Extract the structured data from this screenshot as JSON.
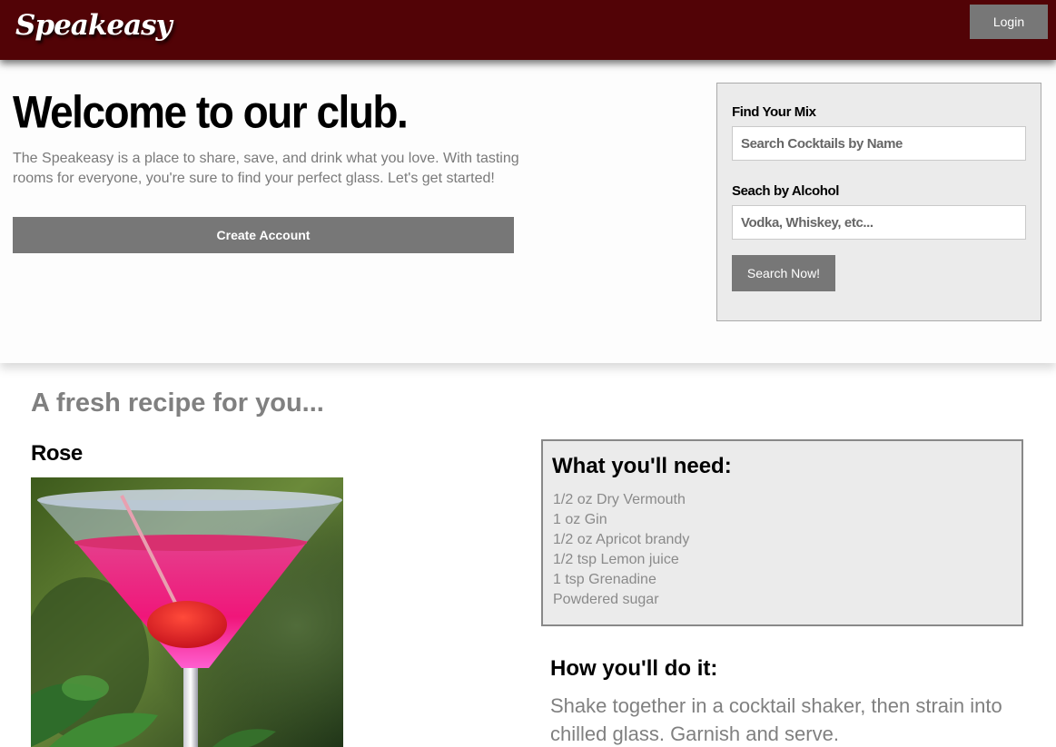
{
  "navbar": {
    "brand": "Speakeasy",
    "login_label": "Login"
  },
  "hero": {
    "title": "Welcome to our club.",
    "description": "The Speakeasy is a place to share, save, and drink what you love. With tasting rooms for everyone, you're sure to find your perfect glass. Let's get started!",
    "create_account_label": "Create Account"
  },
  "search": {
    "name_label": "Find Your Mix",
    "name_placeholder": "Search Cocktails by Name",
    "alcohol_label": "Seach by Alcohol",
    "alcohol_placeholder": "Vodka, Whiskey, etc...",
    "submit_label": "Search Now!"
  },
  "recipe": {
    "section_heading": "A fresh recipe for you...",
    "name": "Rose",
    "ingredients_heading": "What you'll need:",
    "ingredients": [
      "1/2 oz Dry Vermouth",
      "1 oz Gin",
      "1/2 oz Apricot brandy",
      "1/2 tsp Lemon juice",
      "1 tsp Grenadine",
      "Powdered sugar"
    ],
    "instructions_heading": "How you'll do it:",
    "instructions": "Shake together in a cocktail shaker, then strain into chilled glass. Garnish and serve."
  },
  "colors": {
    "navbar": "#520306",
    "button": "#777777",
    "panel": "#ebebeb"
  }
}
